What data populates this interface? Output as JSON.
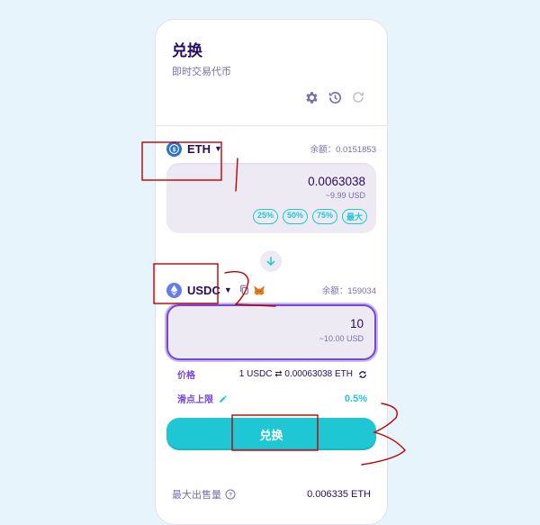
{
  "header": {
    "title": "兑换",
    "subtitle": "即时交易代币"
  },
  "toolbar": {
    "icons": [
      "settings-gear-icon",
      "history-icon",
      "refresh-icon"
    ]
  },
  "from": {
    "token": "ETH",
    "balance_label": "余额：0.0151853",
    "amount": "0.0063038",
    "usd": "~9.99 USD",
    "percent_buttons": [
      "25%",
      "50%",
      "75%",
      "最大"
    ]
  },
  "to": {
    "token": "USDC",
    "balance_label": "余额：159034",
    "amount": "10",
    "usd": "~10.00 USD"
  },
  "price": {
    "label": "价格",
    "value": "1 USDC ⇄ 0.00063038 ETH"
  },
  "slippage": {
    "label": "滑点上限",
    "value": "0.5%"
  },
  "swap_button": "兑换",
  "summary": {
    "max_sold_label": "最大出售量",
    "max_sold_value": "0.006335 ETH"
  },
  "colors": {
    "primary": "#1fc7d4",
    "secondary": "#7645d9",
    "text": "#280d5f",
    "annotation": "#c00000"
  }
}
